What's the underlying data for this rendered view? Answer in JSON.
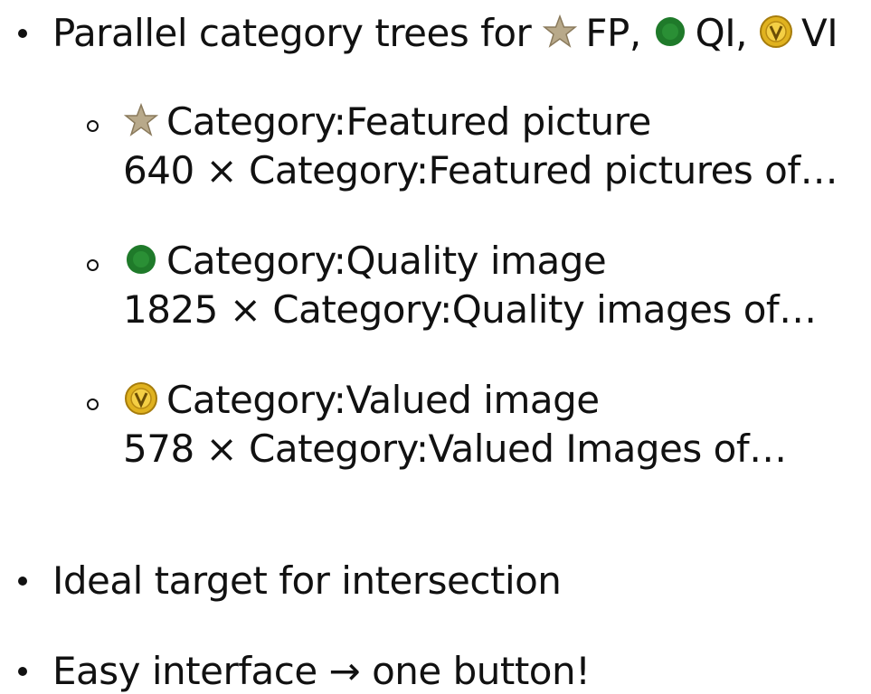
{
  "bullets": {
    "parallel": {
      "prefix": "Parallel category trees for",
      "fp_label": "FP,",
      "qi_label": "QI,",
      "vi_label": "VI"
    },
    "sub_items": [
      {
        "icon": "featured-star-icon",
        "category": "Category:Featured picture",
        "detail": "640 × Category:Featured pictures of…"
      },
      {
        "icon": "quality-seal-icon",
        "category": "Category:Quality image",
        "detail": "1825 × Category:Quality images of…"
      },
      {
        "icon": "valued-medal-icon",
        "category": "Category:Valued image",
        "detail": "578 × Category:Valued Images of…"
      }
    ],
    "intersection": "Ideal target for intersection",
    "easy": "Easy interface → one button!"
  },
  "colors": {
    "text": "#111111",
    "star": "#b8a98a",
    "quality_green": "#1f7a2a",
    "valued_gold": "#e0b21f"
  }
}
